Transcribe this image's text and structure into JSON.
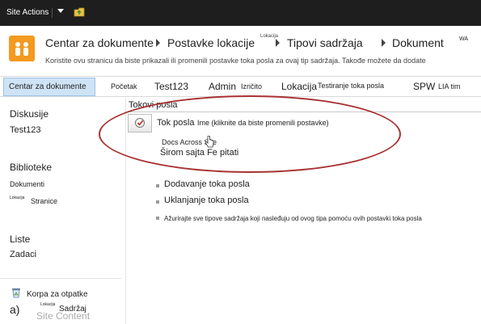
{
  "ribbon": {
    "site_actions": "Site Actions"
  },
  "breadcrumb": {
    "items": [
      "Centar za dokumente",
      "Postavke lokacije",
      "Tipovi sadržaja",
      "Dokument"
    ],
    "sup_label": "Lokacija",
    "overflow": "WA"
  },
  "page_description": "Koristite ovu stranicu da biste prikazali ili promenili postavke toka posla za ovaj tip sadržaja. Takođe možete da dodate",
  "nav": {
    "selected": "Centar za dokumente",
    "items": [
      {
        "label": "Početak"
      },
      {
        "label": "Test123"
      },
      {
        "label": "Admin"
      },
      {
        "label": "Izričito"
      },
      {
        "label": "Lokacija"
      },
      {
        "label": "Testiranje toka posla"
      },
      {
        "label": "SPW"
      },
      {
        "label": "LIA tim"
      }
    ]
  },
  "quicklaunch": {
    "groups": [
      {
        "heading": "Diskusije",
        "items": [
          "Test123"
        ]
      },
      {
        "heading": "Biblioteke",
        "items": [
          "Dokumenti",
          "Stranice"
        ],
        "sup": "Lokacija"
      },
      {
        "heading": "Liste",
        "items": [
          "Zadaci"
        ]
      }
    ],
    "recycle_bin": "Korpa za otpatke",
    "footer_prefix": "a)",
    "footer_sup": "Lokacija",
    "footer_label": "Sadržaj",
    "footer_ghost": "Site Content"
  },
  "content": {
    "section_title": "Tokovi posla",
    "workflow_button_label": "Tok posla",
    "workflow_name_header": "Ime (kliknite da biste promenili postavke)",
    "docs_across": "Docs Across Sve",
    "site_wide": "Širom sajta Fe pitati",
    "actions": [
      "Dodavanje toka posla",
      "Uklanjanje toka posla",
      "Ažurirajte sve tipove sadržaja koji nasleđuju od ovog tipa pomoću ovih postavki toka posla"
    ]
  },
  "colors": {
    "ribbon": "#1e1e1e",
    "logo": "#f39a1f",
    "nav_selected": "#cfe3f6",
    "oval": "#a83232"
  },
  "icons": [
    "arrow-down-icon",
    "folder-up-icon",
    "site-logo-icon",
    "workflow-icon",
    "recycle-bin-icon",
    "hand-cursor-icon"
  ]
}
